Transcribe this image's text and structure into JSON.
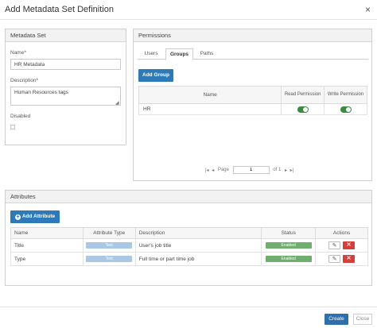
{
  "dialog": {
    "title": "Add Metadata Set Definition",
    "close_glyph": "×"
  },
  "metadata_set": {
    "header": "Metadata Set",
    "name_label": "Name*",
    "name_value": "HR Metadata",
    "description_label": "Description*",
    "description_value": "Human Resources tags",
    "disabled_label": "Disabled"
  },
  "permissions": {
    "header": "Permissions",
    "tabs": [
      "Users",
      "Groups",
      "Paths"
    ],
    "active_tab": "Groups",
    "add_group_label": "Add Group",
    "columns": {
      "name": "Name",
      "read": "Read Permission",
      "write": "Write Permission"
    },
    "rows": [
      {
        "name": "HR",
        "read": true,
        "write": true
      }
    ],
    "pager": {
      "page_label": "Page",
      "page_value": "1",
      "of_label": "of 1"
    }
  },
  "attributes": {
    "header": "Attributes",
    "add_label": "Add Attribute",
    "columns": [
      "Name",
      "Attribute Type",
      "Description",
      "Status",
      "Actions"
    ],
    "rows": [
      {
        "name": "Title",
        "type": "Text",
        "description": "User's job title",
        "status": "Enabled"
      },
      {
        "name": "Type",
        "type": "Text",
        "description": "Full time or part time job",
        "status": "Enabled"
      }
    ]
  },
  "footer": {
    "create_label": "Create",
    "close_label": "Close"
  },
  "colors": {
    "primary": "#2e7ab8",
    "toggle_on": "#3b8a3e",
    "status_enabled": "#6fae6f",
    "delete": "#d43f3a"
  }
}
